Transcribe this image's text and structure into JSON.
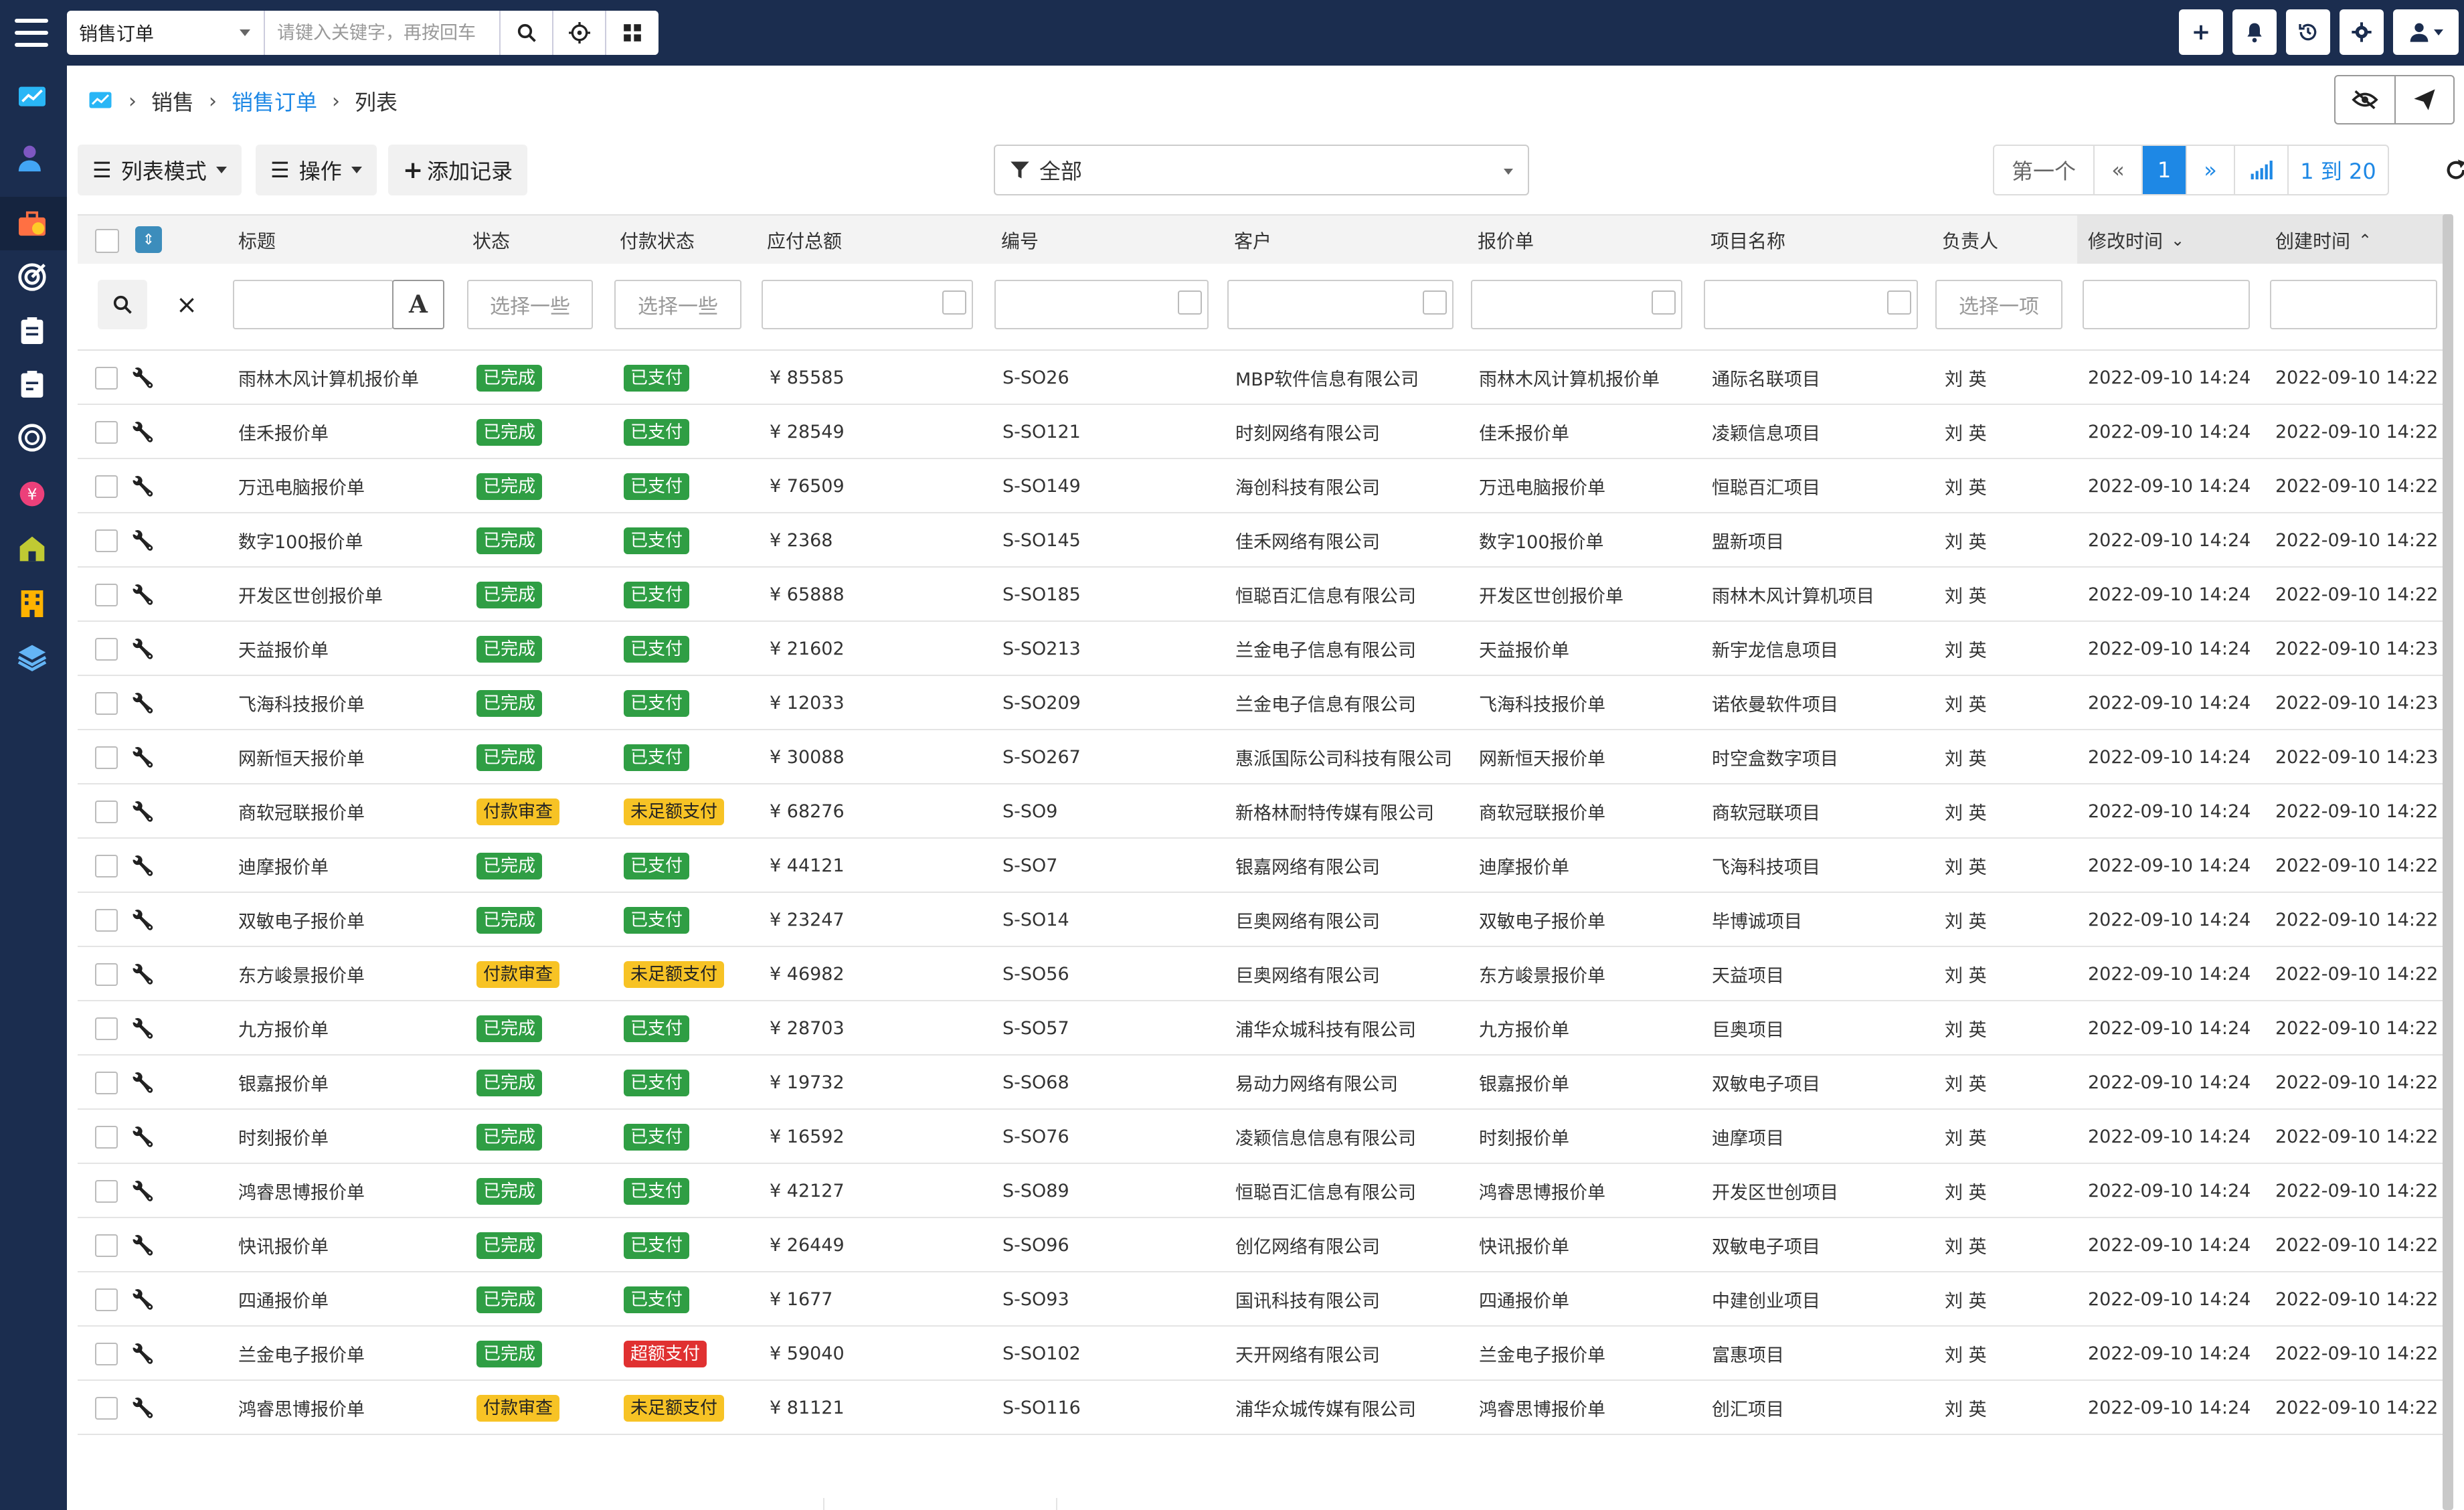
{
  "topbar": {
    "module_select": "销售订单",
    "search_placeholder": "请键入关键字，再按回车",
    "icons": [
      "menu-icon",
      "search-icon",
      "crosshair-icon",
      "grid-icon",
      "plus-icon",
      "bell-icon",
      "history-icon",
      "gear-icon",
      "user-icon"
    ]
  },
  "breadcrumb": {
    "items": [
      "销售",
      "销售订单",
      "列表"
    ]
  },
  "toolbar": {
    "list_mode": "列表模式",
    "actions": "操作",
    "add_record": "添加记录",
    "filter_value": "全部"
  },
  "pager": {
    "first": "第一个",
    "prev": "«",
    "current": "1",
    "next": "»",
    "range": "1 到 20"
  },
  "table": {
    "columns": [
      "标题",
      "状态",
      "付款状态",
      "应付总额",
      "编号",
      "客户",
      "报价单",
      "项目名称",
      "负责人",
      "修改时间",
      "创建时间"
    ],
    "filters": {
      "status_placeholder": "选择一些",
      "pay_status_placeholder": "选择一些",
      "owner_placeholder": "选择一项"
    },
    "rows": [
      {
        "title": "雨林木风计算机报价单",
        "status": "已完成",
        "pay": "已支付",
        "amount": "¥ 85585",
        "code": "S-SO26",
        "customer": "MBP软件信息有限公司",
        "quote": "雨林木风计算机报价单",
        "project": "通际名联项目",
        "owner": "刘 英",
        "modified": "2022-09-10 14:24",
        "created": "2022-09-10 14:22"
      },
      {
        "title": "佳禾报价单",
        "status": "已完成",
        "pay": "已支付",
        "amount": "¥ 28549",
        "code": "S-SO121",
        "customer": "时刻网络有限公司",
        "quote": "佳禾报价单",
        "project": "凌颖信息项目",
        "owner": "刘 英",
        "modified": "2022-09-10 14:24",
        "created": "2022-09-10 14:22"
      },
      {
        "title": "万迅电脑报价单",
        "status": "已完成",
        "pay": "已支付",
        "amount": "¥ 76509",
        "code": "S-SO149",
        "customer": "海创科技有限公司",
        "quote": "万迅电脑报价单",
        "project": "恒聪百汇项目",
        "owner": "刘 英",
        "modified": "2022-09-10 14:24",
        "created": "2022-09-10 14:22"
      },
      {
        "title": "数字100报价单",
        "status": "已完成",
        "pay": "已支付",
        "amount": "¥ 2368",
        "code": "S-SO145",
        "customer": "佳禾网络有限公司",
        "quote": "数字100报价单",
        "project": "盟新项目",
        "owner": "刘 英",
        "modified": "2022-09-10 14:24",
        "created": "2022-09-10 14:22"
      },
      {
        "title": "开发区世创报价单",
        "status": "已完成",
        "pay": "已支付",
        "amount": "¥ 65888",
        "code": "S-SO185",
        "customer": "恒聪百汇信息有限公司",
        "quote": "开发区世创报价单",
        "project": "雨林木风计算机项目",
        "owner": "刘 英",
        "modified": "2022-09-10 14:24",
        "created": "2022-09-10 14:22"
      },
      {
        "title": "天益报价单",
        "status": "已完成",
        "pay": "已支付",
        "amount": "¥ 21602",
        "code": "S-SO213",
        "customer": "兰金电子信息有限公司",
        "quote": "天益报价单",
        "project": "新宇龙信息项目",
        "owner": "刘 英",
        "modified": "2022-09-10 14:24",
        "created": "2022-09-10 14:23"
      },
      {
        "title": "飞海科技报价单",
        "status": "已完成",
        "pay": "已支付",
        "amount": "¥ 12033",
        "code": "S-SO209",
        "customer": "兰金电子信息有限公司",
        "quote": "飞海科技报价单",
        "project": "诺依曼软件项目",
        "owner": "刘 英",
        "modified": "2022-09-10 14:24",
        "created": "2022-09-10 14:23"
      },
      {
        "title": "网新恒天报价单",
        "status": "已完成",
        "pay": "已支付",
        "amount": "¥ 30088",
        "code": "S-SO267",
        "customer": "惠派国际公司科技有限公司",
        "quote": "网新恒天报价单",
        "project": "时空盒数字项目",
        "owner": "刘 英",
        "modified": "2022-09-10 14:24",
        "created": "2022-09-10 14:23"
      },
      {
        "title": "商软冠联报价单",
        "status": "付款审查",
        "pay": "未足额支付",
        "amount": "¥ 68276",
        "code": "S-SO9",
        "customer": "新格林耐特传媒有限公司",
        "quote": "商软冠联报价单",
        "project": "商软冠联项目",
        "owner": "刘 英",
        "modified": "2022-09-10 14:24",
        "created": "2022-09-10 14:22"
      },
      {
        "title": "迪摩报价单",
        "status": "已完成",
        "pay": "已支付",
        "amount": "¥ 44121",
        "code": "S-SO7",
        "customer": "银嘉网络有限公司",
        "quote": "迪摩报价单",
        "project": "飞海科技项目",
        "owner": "刘 英",
        "modified": "2022-09-10 14:24",
        "created": "2022-09-10 14:22"
      },
      {
        "title": "双敏电子报价单",
        "status": "已完成",
        "pay": "已支付",
        "amount": "¥ 23247",
        "code": "S-SO14",
        "customer": "巨奥网络有限公司",
        "quote": "双敏电子报价单",
        "project": "毕博诚项目",
        "owner": "刘 英",
        "modified": "2022-09-10 14:24",
        "created": "2022-09-10 14:22"
      },
      {
        "title": "东方峻景报价单",
        "status": "付款审查",
        "pay": "未足额支付",
        "amount": "¥ 46982",
        "code": "S-SO56",
        "customer": "巨奥网络有限公司",
        "quote": "东方峻景报价单",
        "project": "天益项目",
        "owner": "刘 英",
        "modified": "2022-09-10 14:24",
        "created": "2022-09-10 14:22"
      },
      {
        "title": "九方报价单",
        "status": "已完成",
        "pay": "已支付",
        "amount": "¥ 28703",
        "code": "S-SO57",
        "customer": "浦华众城科技有限公司",
        "quote": "九方报价单",
        "project": "巨奥项目",
        "owner": "刘 英",
        "modified": "2022-09-10 14:24",
        "created": "2022-09-10 14:22"
      },
      {
        "title": "银嘉报价单",
        "status": "已完成",
        "pay": "已支付",
        "amount": "¥ 19732",
        "code": "S-SO68",
        "customer": "易动力网络有限公司",
        "quote": "银嘉报价单",
        "project": "双敏电子项目",
        "owner": "刘 英",
        "modified": "2022-09-10 14:24",
        "created": "2022-09-10 14:22"
      },
      {
        "title": "时刻报价单",
        "status": "已完成",
        "pay": "已支付",
        "amount": "¥ 16592",
        "code": "S-SO76",
        "customer": "凌颖信息信息有限公司",
        "quote": "时刻报价单",
        "project": "迪摩项目",
        "owner": "刘 英",
        "modified": "2022-09-10 14:24",
        "created": "2022-09-10 14:22"
      },
      {
        "title": "鸿睿思博报价单",
        "status": "已完成",
        "pay": "已支付",
        "amount": "¥ 42127",
        "code": "S-SO89",
        "customer": "恒聪百汇信息有限公司",
        "quote": "鸿睿思博报价单",
        "project": "开发区世创项目",
        "owner": "刘 英",
        "modified": "2022-09-10 14:24",
        "created": "2022-09-10 14:22"
      },
      {
        "title": "快讯报价单",
        "status": "已完成",
        "pay": "已支付",
        "amount": "¥ 26449",
        "code": "S-SO96",
        "customer": "创亿网络有限公司",
        "quote": "快讯报价单",
        "project": "双敏电子项目",
        "owner": "刘 英",
        "modified": "2022-09-10 14:24",
        "created": "2022-09-10 14:22"
      },
      {
        "title": "四通报价单",
        "status": "已完成",
        "pay": "已支付",
        "amount": "¥ 1677",
        "code": "S-SO93",
        "customer": "国讯科技有限公司",
        "quote": "四通报价单",
        "project": "中建创业项目",
        "owner": "刘 英",
        "modified": "2022-09-10 14:24",
        "created": "2022-09-10 14:22"
      },
      {
        "title": "兰金电子报价单",
        "status": "已完成",
        "pay": "超额支付",
        "amount": "¥ 59040",
        "code": "S-SO102",
        "customer": "天开网络有限公司",
        "quote": "兰金电子报价单",
        "project": "富惠项目",
        "owner": "刘 英",
        "modified": "2022-09-10 14:24",
        "created": "2022-09-10 14:22"
      },
      {
        "title": "鸿睿思博报价单",
        "status": "付款审查",
        "pay": "未足额支付",
        "amount": "¥ 81121",
        "code": "S-SO116",
        "customer": "浦华众城传媒有限公司",
        "quote": "鸿睿思博报价单",
        "project": "创汇项目",
        "owner": "刘 英",
        "modified": "2022-09-10 14:24",
        "created": "2022-09-10 14:22"
      }
    ]
  },
  "colors": {
    "nav_bg": "#1b2d4f",
    "accent": "#1e88e5",
    "badge_done": "#2f9e44",
    "badge_review": "#f7c325",
    "badge_over": "#e03131"
  }
}
